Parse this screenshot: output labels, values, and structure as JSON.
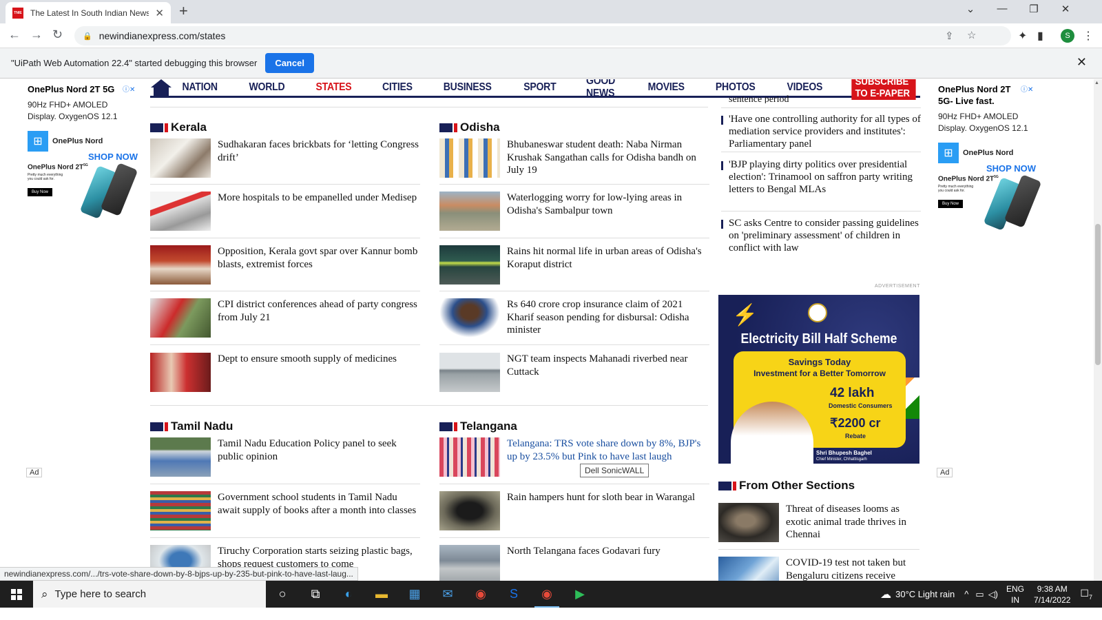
{
  "browser": {
    "tab_title": "The Latest In South Indian News,",
    "favicon": "TNIE",
    "url": "newindianexpress.com/states",
    "profile_initial": "S"
  },
  "infobar": {
    "message": "\"UiPath Web Automation 22.4\" started debugging this browser",
    "cancel": "Cancel"
  },
  "ads": {
    "left": {
      "title": "OnePlus Nord 2T 5G",
      "desc": "90Hz FHD+ AMOLED Display. OxygenOS 12.1",
      "brand": "OnePlus Nord",
      "shop": "SHOP NOW",
      "model": "OnePlus Nord 2T",
      "model_sup": "5G",
      "tagline": "Pretty much everything you could ask for.",
      "buy": "Buy Now",
      "label": "Ad"
    },
    "right": {
      "title": "OnePlus Nord 2T 5G- Live fast.",
      "desc": "90Hz FHD+ AMOLED Display. OxygenOS 12.1",
      "brand": "OnePlus Nord",
      "shop": "SHOP NOW",
      "model": "OnePlus Nord 2T",
      "model_sup": "5G",
      "tagline": "Pretty much everything you could ask for.",
      "buy": "Buy Now",
      "label": "Ad"
    }
  },
  "nav": {
    "items": [
      "NATION",
      "WORLD",
      "STATES",
      "CITIES",
      "BUSINESS",
      "SPORT",
      "GOOD NEWS",
      "MOVIES",
      "PHOTOS",
      "VIDEOS"
    ],
    "active": "STATES",
    "epaper": "SUBSCRIBE TO E-PAPER"
  },
  "sections": {
    "kerala": {
      "name": "Kerala",
      "stories": [
        "Sudhakaran faces brickbats for ‘letting Congress drift’",
        "More hospitals to be empanelled under Medisep",
        "Opposition, Kerala govt spar over Kannur bomb blasts, extremist forces",
        "CPI district conferences ahead of party congress from July 21",
        "Dept to ensure smooth supply of medicines"
      ]
    },
    "odisha": {
      "name": "Odisha",
      "stories": [
        "Bhubaneswar student death: Naba Nirman Krushak Sangathan calls for Odisha bandh on July 19",
        "Waterlogging worry for low-lying areas in Odisha's Sambalpur town",
        "Rains hit normal life in urban areas of Odisha's Koraput district",
        "Rs 640 crore crop insurance claim of 2021 Kharif season pending for disbursal: Odisha minister",
        "NGT team inspects Mahanadi riverbed near Cuttack"
      ]
    },
    "tamilnadu": {
      "name": "Tamil Nadu",
      "stories": [
        "Tamil Nadu Education Policy panel to seek public opinion",
        "Government school students in Tamil Nadu await supply of books after a month into classes",
        "Tiruchy Corporation starts seizing plastic bags, shops request customers to come"
      ]
    },
    "telangana": {
      "name": "Telangana",
      "stories": [
        "Telangana: TRS vote share down by 8%, BJP's up by 23.5% but Pink to have last laugh",
        "Rain hampers hunt for sloth bear in Warangal",
        "North Telangana faces Godavari fury"
      ]
    }
  },
  "sidebar": {
    "cut_top": "sentence period",
    "items": [
      "'Have one controlling authority for all types of mediation service providers and institutes': Parliamentary panel",
      "'BJP playing dirty politics over presidential election': Trinamool on saffron party writing letters to Bengal MLAs",
      "SC asks Centre to consider passing guidelines on 'preliminary assessment' of children in conflict with law"
    ],
    "ad_label": "ADVERTISEMENT"
  },
  "govad": {
    "title": "Electricity Bill Half Scheme",
    "line1": "Savings Today",
    "line2": "Investment for a Better Tomorrow",
    "num1": "42 lakh",
    "num1_sub": "Domestic Consumers",
    "num2": "₹2200 cr",
    "num2_sub": "Rebate",
    "name": "Shri Bhupesh Baghel",
    "role": "Chief Minister, Chhattisgarh"
  },
  "other": {
    "name": "From Other Sections",
    "stories": [
      "Threat of diseases looms as exotic animal trade thrives in Chennai",
      "COVID-19 test not taken but Bengaluru citizens receive"
    ]
  },
  "tooltip": "Dell SonicWALL",
  "status_url": "newindianexpress.com/.../trs-vote-share-down-by-8-bjps-up-by-235-but-pink-to-have-last-laug...",
  "taskbar": {
    "search": "Type here to search",
    "weather": "30°C  Light rain",
    "lang1": "ENG",
    "lang2": "IN",
    "time": "9:38 AM",
    "date": "7/14/2022",
    "notif": "7"
  },
  "colors": {
    "brand_navy": "#182057",
    "brand_red": "#d7141a",
    "link_blue": "#1a4fa0",
    "chrome_blue": "#1a73e8"
  }
}
